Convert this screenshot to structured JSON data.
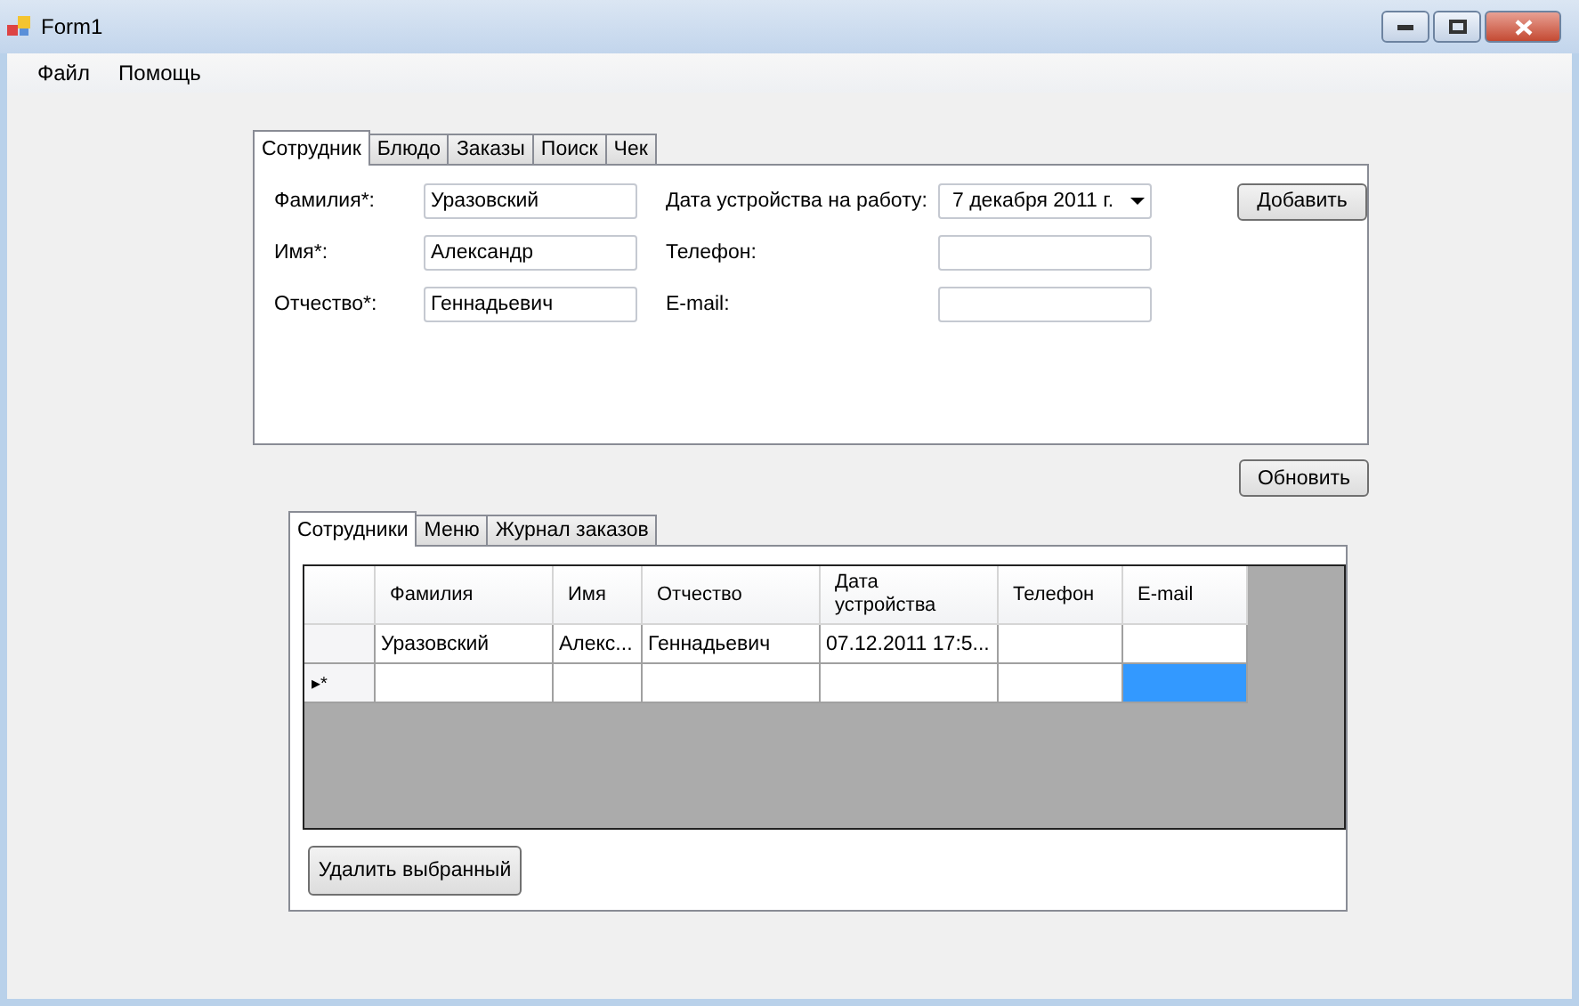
{
  "window": {
    "title": "Form1"
  },
  "menu": [
    "Файл",
    "Помощь"
  ],
  "top_tabs": [
    {
      "label": "Сотрудник",
      "selected": true
    },
    {
      "label": "Блюдо",
      "selected": false
    },
    {
      "label": "Заказы",
      "selected": false
    },
    {
      "label": "Поиск",
      "selected": false
    },
    {
      "label": "Чек",
      "selected": false
    }
  ],
  "form": {
    "surname": {
      "label": "Фамилия*:",
      "value": "Уразовский"
    },
    "name": {
      "label": "Имя*:",
      "value": "Александр"
    },
    "patronymic": {
      "label": "Отчество*:",
      "value": "Геннадьевич"
    },
    "hire_date": {
      "label": "Дата устройства на работу:",
      "value": "7 декабря  2011 г."
    },
    "phone": {
      "label": "Телефон:"
    },
    "email": {
      "label": "E-mail:"
    },
    "add_button": "Добавить"
  },
  "refresh_button": "Обновить",
  "bottom_tabs": [
    {
      "label": "Сотрудники",
      "selected": true
    },
    {
      "label": "Меню",
      "selected": false
    },
    {
      "label": "Журнал заказов",
      "selected": false
    }
  ],
  "table": {
    "columns": [
      "Фамилия",
      "Имя",
      "Отчество",
      "Дата устройства",
      "Телефон",
      "E-mail"
    ],
    "rows": [
      {
        "kind": "data",
        "cells": [
          {
            "text": "Уразовский",
            "selected": false
          },
          {
            "text": "Алекс...",
            "selected": false
          },
          {
            "text": "Геннадьевич",
            "selected": false
          },
          {
            "text": "07.12.2011 17:5...",
            "selected": false
          },
          {
            "selected": false
          },
          {
            "selected": false
          }
        ]
      },
      {
        "kind": "new",
        "marker": "▸*",
        "cells": [
          {
            "selected": false
          },
          {
            "selected": false
          },
          {
            "selected": false
          },
          {
            "selected": false
          },
          {
            "selected": false
          },
          {
            "selected": true
          }
        ]
      }
    ]
  },
  "delete_button": "Удалить выбранный"
}
